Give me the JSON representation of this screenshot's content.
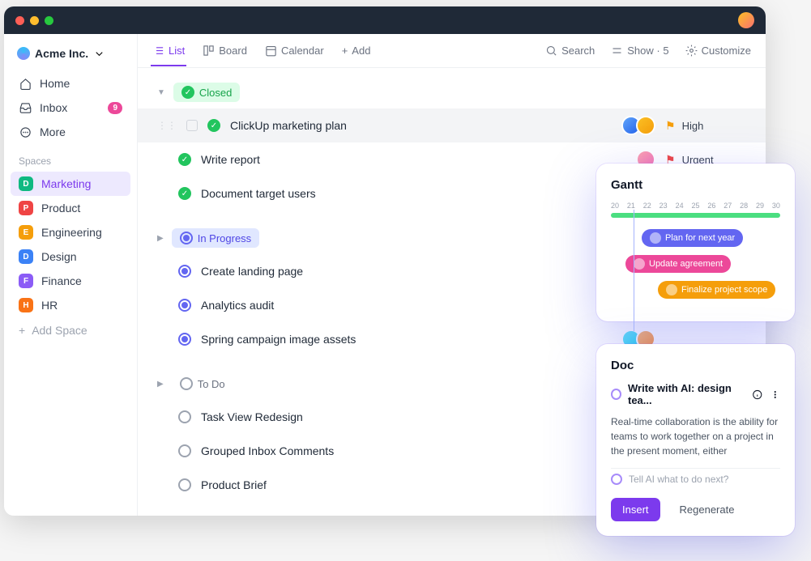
{
  "workspace": {
    "name": "Acme Inc."
  },
  "nav": {
    "home": "Home",
    "inbox": "Inbox",
    "inbox_badge": "9",
    "more": "More",
    "spaces_label": "Spaces",
    "add_space": "Add Space"
  },
  "spaces": [
    {
      "letter": "D",
      "name": "Marketing",
      "color": "#10b981",
      "active": true
    },
    {
      "letter": "P",
      "name": "Product",
      "color": "#ef4444"
    },
    {
      "letter": "E",
      "name": "Engineering",
      "color": "#f59e0b"
    },
    {
      "letter": "D",
      "name": "Design",
      "color": "#3b82f6"
    },
    {
      "letter": "F",
      "name": "Finance",
      "color": "#8b5cf6"
    },
    {
      "letter": "H",
      "name": "HR",
      "color": "#f97316"
    }
  ],
  "toolbar": {
    "list": "List",
    "board": "Board",
    "calendar": "Calendar",
    "add": "Add",
    "search": "Search",
    "show": "Show · 5",
    "customize": "Customize"
  },
  "groups": {
    "closed": {
      "label": "Closed"
    },
    "in_progress": {
      "label": "In Progress"
    },
    "todo": {
      "label": "To Do"
    }
  },
  "tasks": {
    "closed": [
      {
        "title": "ClickUp marketing plan",
        "priority": "High",
        "flag_color": "#f59e0b"
      },
      {
        "title": "Write report",
        "priority": "Urgent",
        "flag_color": "#ef4444"
      },
      {
        "title": "Document target users"
      }
    ],
    "in_progress": [
      {
        "title": "Create landing page"
      },
      {
        "title": "Analytics audit"
      },
      {
        "title": "Spring campaign image assets"
      }
    ],
    "todo": [
      {
        "title": "Task View Redesign"
      },
      {
        "title": "Grouped Inbox Comments"
      },
      {
        "title": "Product Brief"
      }
    ]
  },
  "gantt": {
    "title": "Gantt",
    "dates": [
      "20",
      "21",
      "22",
      "23",
      "24",
      "25",
      "26",
      "27",
      "28",
      "29",
      "30"
    ],
    "bars": [
      {
        "label": "Plan for next year"
      },
      {
        "label": "Update agreement"
      },
      {
        "label": "Finalize project scope"
      }
    ]
  },
  "doc": {
    "title": "Doc",
    "ai_title": "Write with AI: design tea...",
    "body": "Real-time collaboration is the ability for teams to work together on a project in the present moment, either",
    "prompt": "Tell AI what to do next?",
    "insert": "Insert",
    "regenerate": "Regenerate"
  }
}
